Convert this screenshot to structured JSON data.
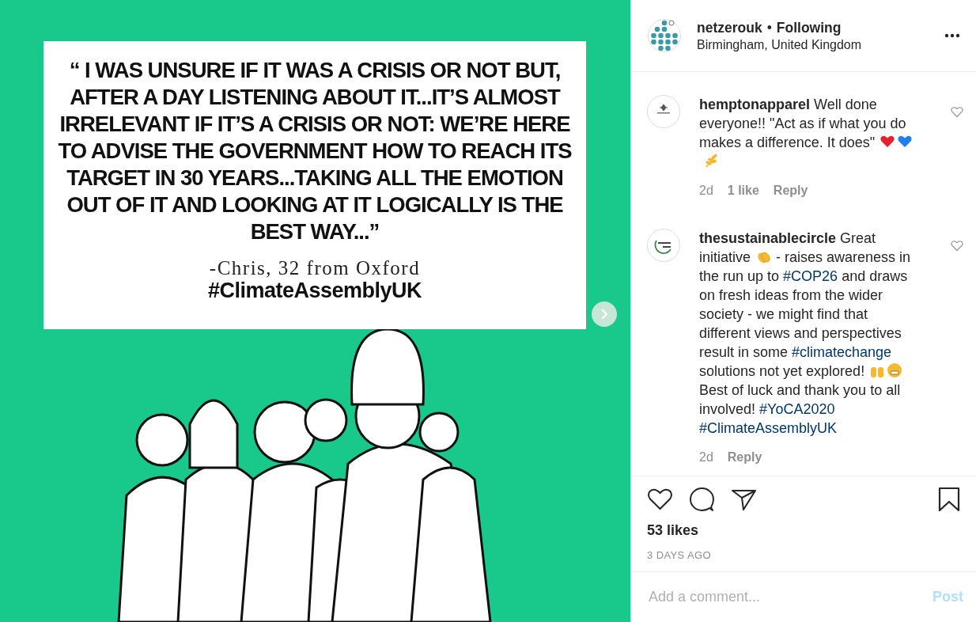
{
  "post_image": {
    "quote": "“ I WAS UNSURE IF IT WAS A CRISIS OR NOT BUT, AFTER A DAY LISTENING ABOUT IT...IT’S ALMOST IRRELEVANT IF IT’S A CRISIS OR NOT: WE’RE HERE TO ADVISE THE GOVERNMENT HOW TO REACH ITS TARGET IN 30 YEARS...TAKING ALL THE EMOTION OUT OF IT AND LOOKING AT IT LOGICALLY IS THE BEST WAY...”",
    "attribution": "-Chris, 32 from Oxford",
    "hashtag": "#ClimateAssemblyUK",
    "kind": "picture"
  },
  "header": {
    "username": "netzerouk",
    "separator": "•",
    "follow_status": "Following",
    "location": "Birmingham, United Kingdom"
  },
  "comments": [
    {
      "username": "hemptonapparel",
      "liked": false,
      "segments": [
        {
          "kind": "text",
          "text": " Well done everyone!! \"Act as if what you do makes a difference. It does\" "
        },
        {
          "kind": "heart",
          "color": "#e8202a"
        },
        {
          "kind": "heart",
          "color": "#1e7ff0"
        },
        {
          "kind": "leaf"
        }
      ],
      "meta": [
        {
          "kind": "time",
          "text": "2d"
        },
        {
          "kind": "likes",
          "text": "1 like"
        },
        {
          "kind": "reply",
          "text": "Reply"
        }
      ]
    },
    {
      "username": "thesustainablecircle",
      "liked": false,
      "segments": [
        {
          "kind": "text",
          "text": " Great initiative "
        },
        {
          "kind": "clap"
        },
        {
          "kind": "text",
          "text": " - raises awareness in the run up to "
        },
        {
          "kind": "tag",
          "text": "#COP26"
        },
        {
          "kind": "text",
          "text": " and draws on fresh ideas from the wider society - we might find that different views and perspectives result in some "
        },
        {
          "kind": "tag",
          "text": "#climatechange"
        },
        {
          "kind": "text",
          "text": " solutions not yet explored! "
        },
        {
          "kind": "hands"
        },
        {
          "kind": "grin"
        },
        {
          "kind": "text",
          "text": " Best of luck and thank you to all involved! "
        },
        {
          "kind": "tag",
          "text": "#YoCA2020"
        },
        {
          "kind": "tag",
          "text": "#ClimateAssemblyUK"
        }
      ],
      "meta": [
        {
          "kind": "time",
          "text": "2d"
        },
        {
          "kind": "reply",
          "text": "Reply"
        }
      ]
    }
  ],
  "likes": "53 likes",
  "date": "3 DAYS AGO",
  "comment_field": {
    "placeholder": "Add a comment...",
    "button": "Post",
    "disabled": true
  }
}
